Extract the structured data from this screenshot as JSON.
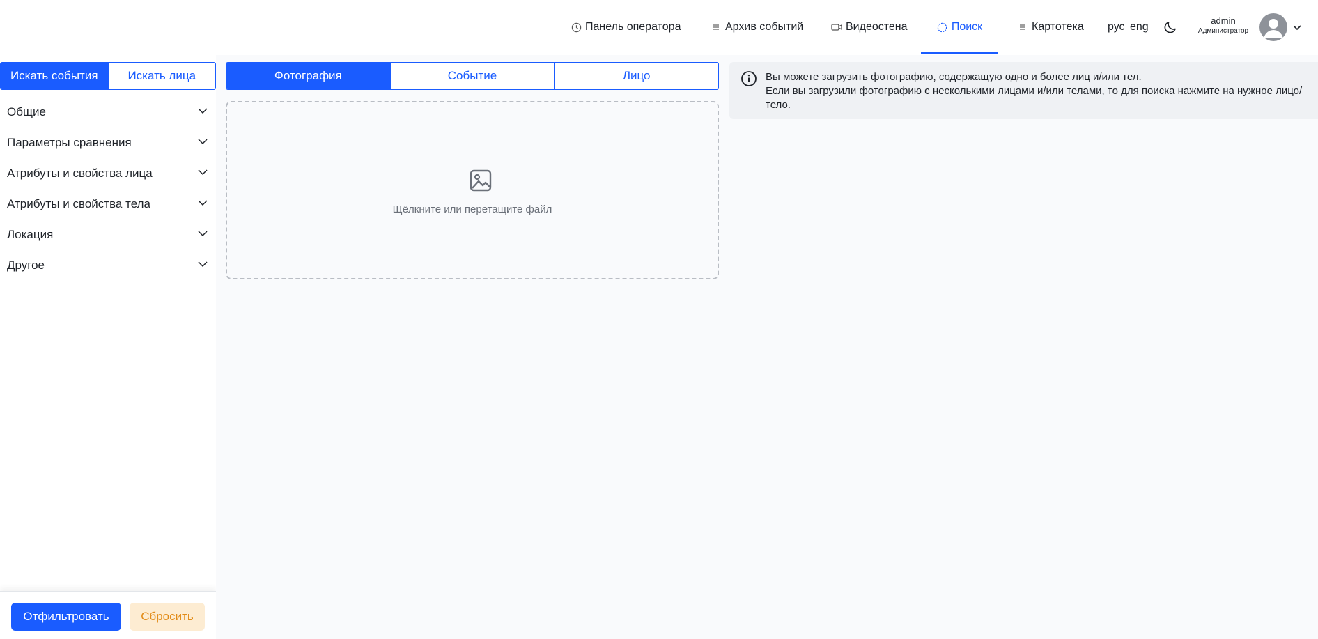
{
  "header": {
    "nav": [
      {
        "label": "Панель оператора",
        "icon": "clock-icon"
      },
      {
        "label": "Архив событий",
        "icon": "list-icon"
      },
      {
        "label": "Видеостена",
        "icon": "video-camera-icon"
      },
      {
        "label": "Поиск",
        "icon": "search-circle-icon",
        "active": true
      },
      {
        "label": "Картотека",
        "icon": "list-icon"
      }
    ],
    "lang_ru": "рус",
    "lang_en": "eng",
    "theme_icon": "moon-icon",
    "user": {
      "name": "admin",
      "role": "Администратор"
    }
  },
  "sidebar": {
    "mode_tabs": [
      {
        "label": "Искать события",
        "active": true
      },
      {
        "label": "Искать лица",
        "active": false
      }
    ],
    "sections": [
      {
        "label": "Общие"
      },
      {
        "label": "Параметры сравнения"
      },
      {
        "label": "Атрибуты и свойства лица"
      },
      {
        "label": "Атрибуты и свойства тела"
      },
      {
        "label": "Локация"
      },
      {
        "label": "Другое"
      }
    ],
    "filter_label": "Отфильтровать",
    "reset_label": "Сбросить"
  },
  "main": {
    "source_tabs": [
      {
        "label": "Фотография",
        "active": true
      },
      {
        "label": "Событие",
        "active": false
      },
      {
        "label": "Лицо",
        "active": false
      }
    ],
    "dropzone_text": "Щёлкните или перетащите файл",
    "info_line1": "Вы можете загрузить фотографию, содержащую одно и более лиц и/или тел.",
    "info_line2": "Если вы загрузили фотографию с несколькими лицами и/или телами, то для поиска нажмите на нужное лицо/тело."
  },
  "colors": {
    "accent": "#1a5cff",
    "reset_bg": "#fdecd2",
    "reset_text": "#e28b17"
  }
}
